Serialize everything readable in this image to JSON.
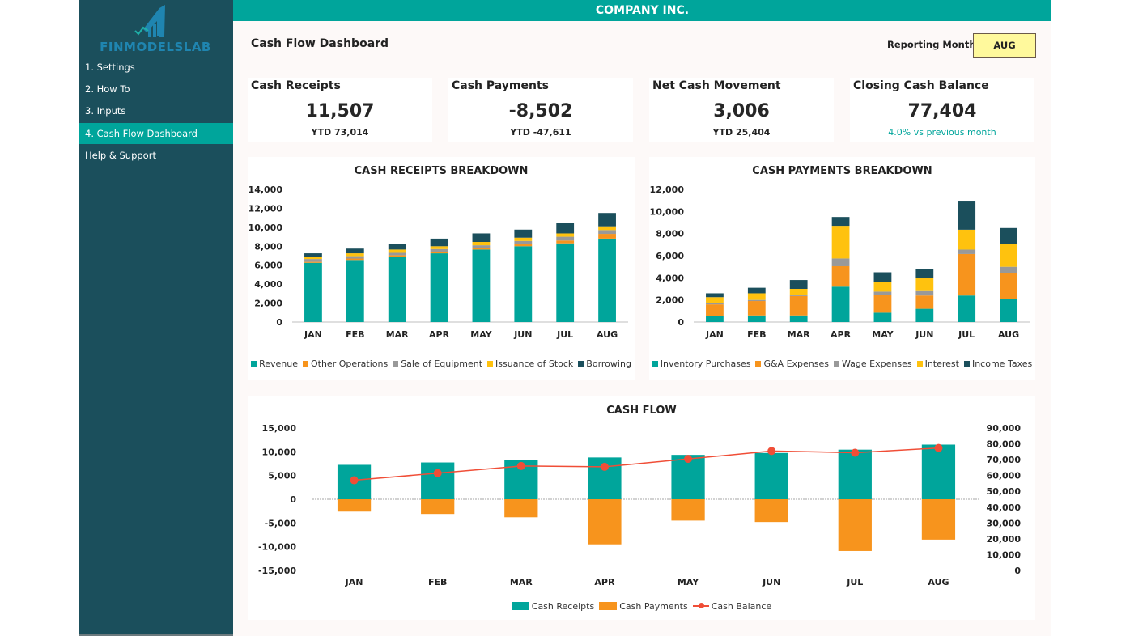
{
  "sidebar": {
    "logo_text": "FINMODELSLAB",
    "items": [
      {
        "label": "1. Settings",
        "active": false
      },
      {
        "label": "2. How To",
        "active": false
      },
      {
        "label": "3. Inputs",
        "active": false
      },
      {
        "label": "4. Cash Flow Dashboard",
        "active": true
      },
      {
        "label": "Help & Support",
        "active": false
      }
    ]
  },
  "header": {
    "company": "COMPANY INC.",
    "page_title": "Cash Flow Dashboard",
    "reporting_month_label": "Reporting Month:",
    "reporting_month_value": "AUG"
  },
  "kpis": [
    {
      "title": "Cash Receipts",
      "value": "11,507",
      "sub": "YTD 73,014",
      "sub_style": "bold"
    },
    {
      "title": "Cash Payments",
      "value": "-8,502",
      "sub": "YTD -47,611",
      "sub_style": "bold"
    },
    {
      "title": "Net Cash Movement",
      "value": "3,006",
      "sub": "YTD 25,404",
      "sub_style": "bold"
    },
    {
      "title": "Closing Cash Balance",
      "value": "77,404",
      "sub": "4.0% vs previous month",
      "sub_style": "teal"
    }
  ],
  "colors": {
    "teal": "#00a59b",
    "orange": "#f7941d",
    "grey": "#999999",
    "yellow": "#ffc20e",
    "dark": "#1b4f5c",
    "line": "#f04e37"
  },
  "chart_data": [
    {
      "id": "receipts",
      "type": "bar",
      "stacked": true,
      "title": "CASH RECEIPTS BREAKDOWN",
      "categories": [
        "JAN",
        "FEB",
        "MAR",
        "APR",
        "MAY",
        "JUN",
        "JUL",
        "AUG"
      ],
      "ylim": [
        0,
        14000
      ],
      "yticks": [
        0,
        2000,
        4000,
        6000,
        8000,
        10000,
        12000,
        14000
      ],
      "ytick_labels": [
        "0",
        "2,000",
        "4,000",
        "6,000",
        "8,000",
        "10,000",
        "12,000",
        "14,000"
      ],
      "legend_position": "bottom",
      "series": [
        {
          "name": "Revenue",
          "color": "#00a59b",
          "values": [
            6250,
            6550,
            6900,
            7250,
            7650,
            8000,
            8300,
            8800
          ]
        },
        {
          "name": "Other Operations",
          "color": "#f7941d",
          "values": [
            100,
            150,
            150,
            150,
            150,
            200,
            300,
            500
          ]
        },
        {
          "name": "Sale of Equipment",
          "color": "#999999",
          "values": [
            300,
            250,
            250,
            300,
            300,
            350,
            400,
            400
          ]
        },
        {
          "name": "Issuance of Stock",
          "color": "#ffc20e",
          "values": [
            250,
            300,
            350,
            300,
            350,
            350,
            350,
            400
          ]
        },
        {
          "name": "Borrowing",
          "color": "#1b4f5c",
          "values": [
            350,
            500,
            600,
            800,
            900,
            850,
            1100,
            1407
          ]
        }
      ]
    },
    {
      "id": "payments",
      "type": "bar",
      "stacked": true,
      "title": "CASH PAYMENTS BREAKDOWN",
      "categories": [
        "JAN",
        "FEB",
        "MAR",
        "APR",
        "MAY",
        "JUN",
        "JUL",
        "AUG"
      ],
      "ylim": [
        0,
        12000
      ],
      "yticks": [
        0,
        2000,
        4000,
        6000,
        8000,
        10000,
        12000
      ],
      "ytick_labels": [
        "0",
        "2,000",
        "4,000",
        "6,000",
        "8,000",
        "10,000",
        "12,000"
      ],
      "legend_position": "bottom",
      "series": [
        {
          "name": "Inventory Purchases",
          "color": "#00a59b",
          "values": [
            550,
            600,
            600,
            3200,
            850,
            1200,
            2400,
            2100
          ]
        },
        {
          "name": "G&A Expenses",
          "color": "#f7941d",
          "values": [
            1050,
            1300,
            1750,
            1850,
            1600,
            1200,
            3750,
            2300
          ]
        },
        {
          "name": "Wage Expenses",
          "color": "#999999",
          "values": [
            150,
            100,
            100,
            700,
            300,
            400,
            400,
            600
          ]
        },
        {
          "name": "Interest",
          "color": "#ffc20e",
          "values": [
            500,
            600,
            550,
            2950,
            850,
            1150,
            1800,
            2050
          ]
        },
        {
          "name": "Income Taxes",
          "color": "#1b4f5c",
          "values": [
            350,
            500,
            800,
            800,
            900,
            850,
            2550,
            1452
          ]
        }
      ]
    },
    {
      "id": "cashflow",
      "type": "bar",
      "title": "CASH FLOW",
      "categories": [
        "JAN",
        "FEB",
        "MAR",
        "APR",
        "MAY",
        "JUN",
        "JUL",
        "AUG"
      ],
      "ylim": [
        -15000,
        15000
      ],
      "yticks": [
        -15000,
        -10000,
        -5000,
        0,
        5000,
        10000,
        15000
      ],
      "ytick_labels": [
        "-15,000",
        "-10,000",
        "-5,000",
        "0",
        "5,000",
        "10,000",
        "15,000"
      ],
      "y2lim": [
        0,
        90000
      ],
      "y2ticks": [
        0,
        10000,
        20000,
        30000,
        40000,
        50000,
        60000,
        70000,
        80000,
        90000
      ],
      "y2tick_labels": [
        "0",
        "10,000",
        "20,000",
        "30,000",
        "40,000",
        "50,000",
        "60,000",
        "70,000",
        "80,000",
        "90,000"
      ],
      "legend_position": "bottom",
      "series": [
        {
          "name": "Cash Receipts",
          "kind": "bar",
          "axis": "left",
          "color": "#00a59b",
          "values": [
            7250,
            7750,
            8250,
            8800,
            9350,
            9750,
            10450,
            11507
          ]
        },
        {
          "name": "Cash Payments",
          "kind": "bar",
          "axis": "left",
          "color": "#f7941d",
          "values": [
            -2600,
            -3100,
            -3800,
            -9500,
            -4500,
            -4800,
            -10900,
            -8502
          ]
        },
        {
          "name": "Cash Balance",
          "kind": "line",
          "axis": "right",
          "color": "#f04e37",
          "values": [
            57000,
            61500,
            66000,
            65500,
            70500,
            75500,
            74400,
            77404
          ]
        }
      ]
    }
  ]
}
